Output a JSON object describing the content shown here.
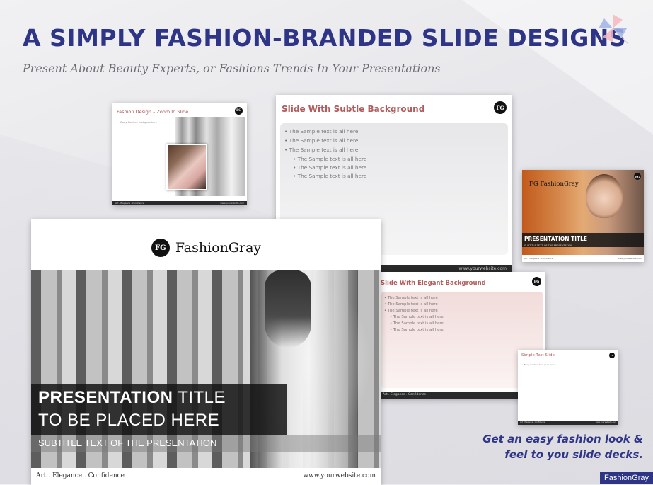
{
  "header": {
    "headline": "A SIMPLY FASHION-BRANDED SLIDE DESIGNS",
    "subheadline": "Present About Beauty Experts, or Fashions Trends In Your Presentations",
    "decor_icon": "pinwheel-icon"
  },
  "colors": {
    "brand_blue": "#2e3586",
    "slide_title_red": "#b25b5b",
    "dark_bar": "#2a2a2a"
  },
  "brand": {
    "logo_text": "FG",
    "name": "FashionGray"
  },
  "slides": {
    "zoom": {
      "title": "Fashion Design – Zoom In Slide",
      "body": "• Body Content text goes here",
      "footer_left": "Art . Elegance . Confidence",
      "footer_right": "www.yourwebsite.com"
    },
    "subtle": {
      "title": "Slide With Subtle Background",
      "bullets": [
        "The Sample text is all here",
        "The Sample text is all here",
        "The Sample text is all here",
        "The Sample text is all here",
        "The Sample text is all here",
        "The Sample text is all here"
      ],
      "footer_right": "www.yourwebsite.com"
    },
    "orange": {
      "title": "PRESENTATION TITLE",
      "subtitle": "SUBTITLE TEXT OF THE PRESENTATION",
      "footer_left": "Art . Elegance . Confidence",
      "footer_right": "www.yourwebsite.com"
    },
    "elegant": {
      "title": "Slide With Elegant Background",
      "bullets": [
        "The Sample text is all here",
        "The Sample text is all here",
        "The Sample text is all here",
        "The Sample text is all here",
        "The Sample text is all here",
        "The Sample text is all here"
      ],
      "footer_left": "Art . Elegance . Confidence"
    },
    "simple": {
      "title": "Simple Text Slide",
      "body": "• Body Content text goes here",
      "footer_left": "Art . Elegance . Confidence",
      "footer_right": "www.yourwebsite.com"
    },
    "main": {
      "title_bold": "PRESENTATION",
      "title_rest": " TITLE",
      "title_line2": "TO BE PLACED HERE",
      "subtitle": "SUBTITLE TEXT OF THE PRESENTATION",
      "footer_left": "Art . Elegance . Confidence",
      "footer_right": "www.yourwebsite.com"
    }
  },
  "tagline": {
    "line1": "Get an easy fashion look &",
    "line2": "feel to you slide decks."
  },
  "badge": "FashionGray"
}
